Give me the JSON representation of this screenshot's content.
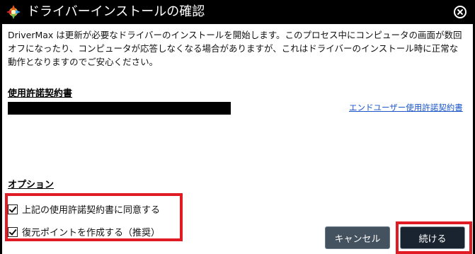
{
  "window": {
    "title": "ドライバーインストールの確認",
    "app_icon": "drivermax-logo-icon",
    "close_icon": "close-circle-icon"
  },
  "description": "DriverMax は更新が必要なドライバーのインストールを開始します。このプロセス中にコンピュータの画面が数回オフになったり、コンピュータが応答しなくなる場合がありますが、これはドライバーのインストール時に正常な動作となりますのでご安心ください。",
  "license": {
    "heading": "使用許諾契約書",
    "link": "エンドユーザー使用許諾契約書"
  },
  "options": {
    "heading": "オプション",
    "items": [
      {
        "label": "上記の使用許諾契約書に同意する",
        "checked": true
      },
      {
        "label": "復元ポイントを作成する（推奨）",
        "checked": true
      }
    ]
  },
  "buttons": {
    "cancel": "キャンセル",
    "continue": "続ける"
  },
  "colors": {
    "accent_red": "#e01b24",
    "link_blue": "#1a56c9",
    "titlebar_bg": "#000000"
  }
}
